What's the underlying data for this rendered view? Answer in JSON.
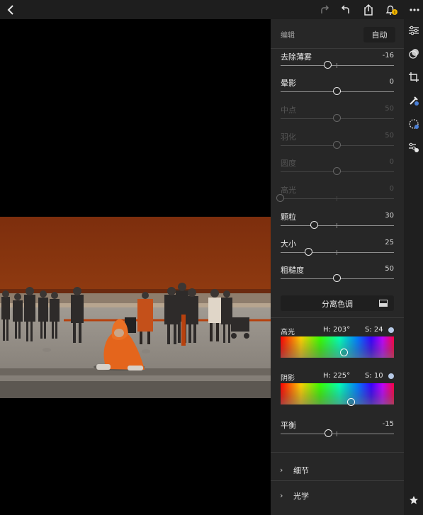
{
  "toolbar": {
    "notification_badge": "!"
  },
  "panel": {
    "title": "编辑",
    "auto_label": "自动",
    "sliders": [
      {
        "label": "去除薄雾",
        "value": "-16",
        "level": 0.42,
        "disabled": false
      },
      {
        "label": "晕影",
        "value": "0",
        "level": 0.5,
        "disabled": false
      },
      {
        "label": "中点",
        "value": "50",
        "level": 0.5,
        "disabled": true
      },
      {
        "label": "羽化",
        "value": "50",
        "level": 0.5,
        "disabled": true
      },
      {
        "label": "圆度",
        "value": "0",
        "level": 0.5,
        "disabled": true
      },
      {
        "label": "高光",
        "value": "0",
        "level": 0.0,
        "disabled": true
      },
      {
        "label": "颗粒",
        "value": "30",
        "level": 0.3,
        "disabled": false
      },
      {
        "label": "大小",
        "value": "25",
        "level": 0.25,
        "disabled": false
      },
      {
        "label": "粗糙度",
        "value": "50",
        "level": 0.5,
        "disabled": false
      }
    ],
    "split_toning_label": "分离色调",
    "highlights": {
      "label": "高光",
      "h": "H: 203°",
      "s": "S: 24",
      "hue": 203,
      "sat": 24
    },
    "shadows": {
      "label": "阴影",
      "h": "H: 225°",
      "s": "S: 10",
      "hue": 225,
      "sat": 10
    },
    "balance": {
      "label": "平衡",
      "value": "-15",
      "level": 0.425
    },
    "sections": [
      {
        "label": "细节"
      },
      {
        "label": "光学"
      }
    ]
  },
  "colors": {
    "panel_bg": "#272727",
    "accent_dot": "#b6c9e6"
  }
}
